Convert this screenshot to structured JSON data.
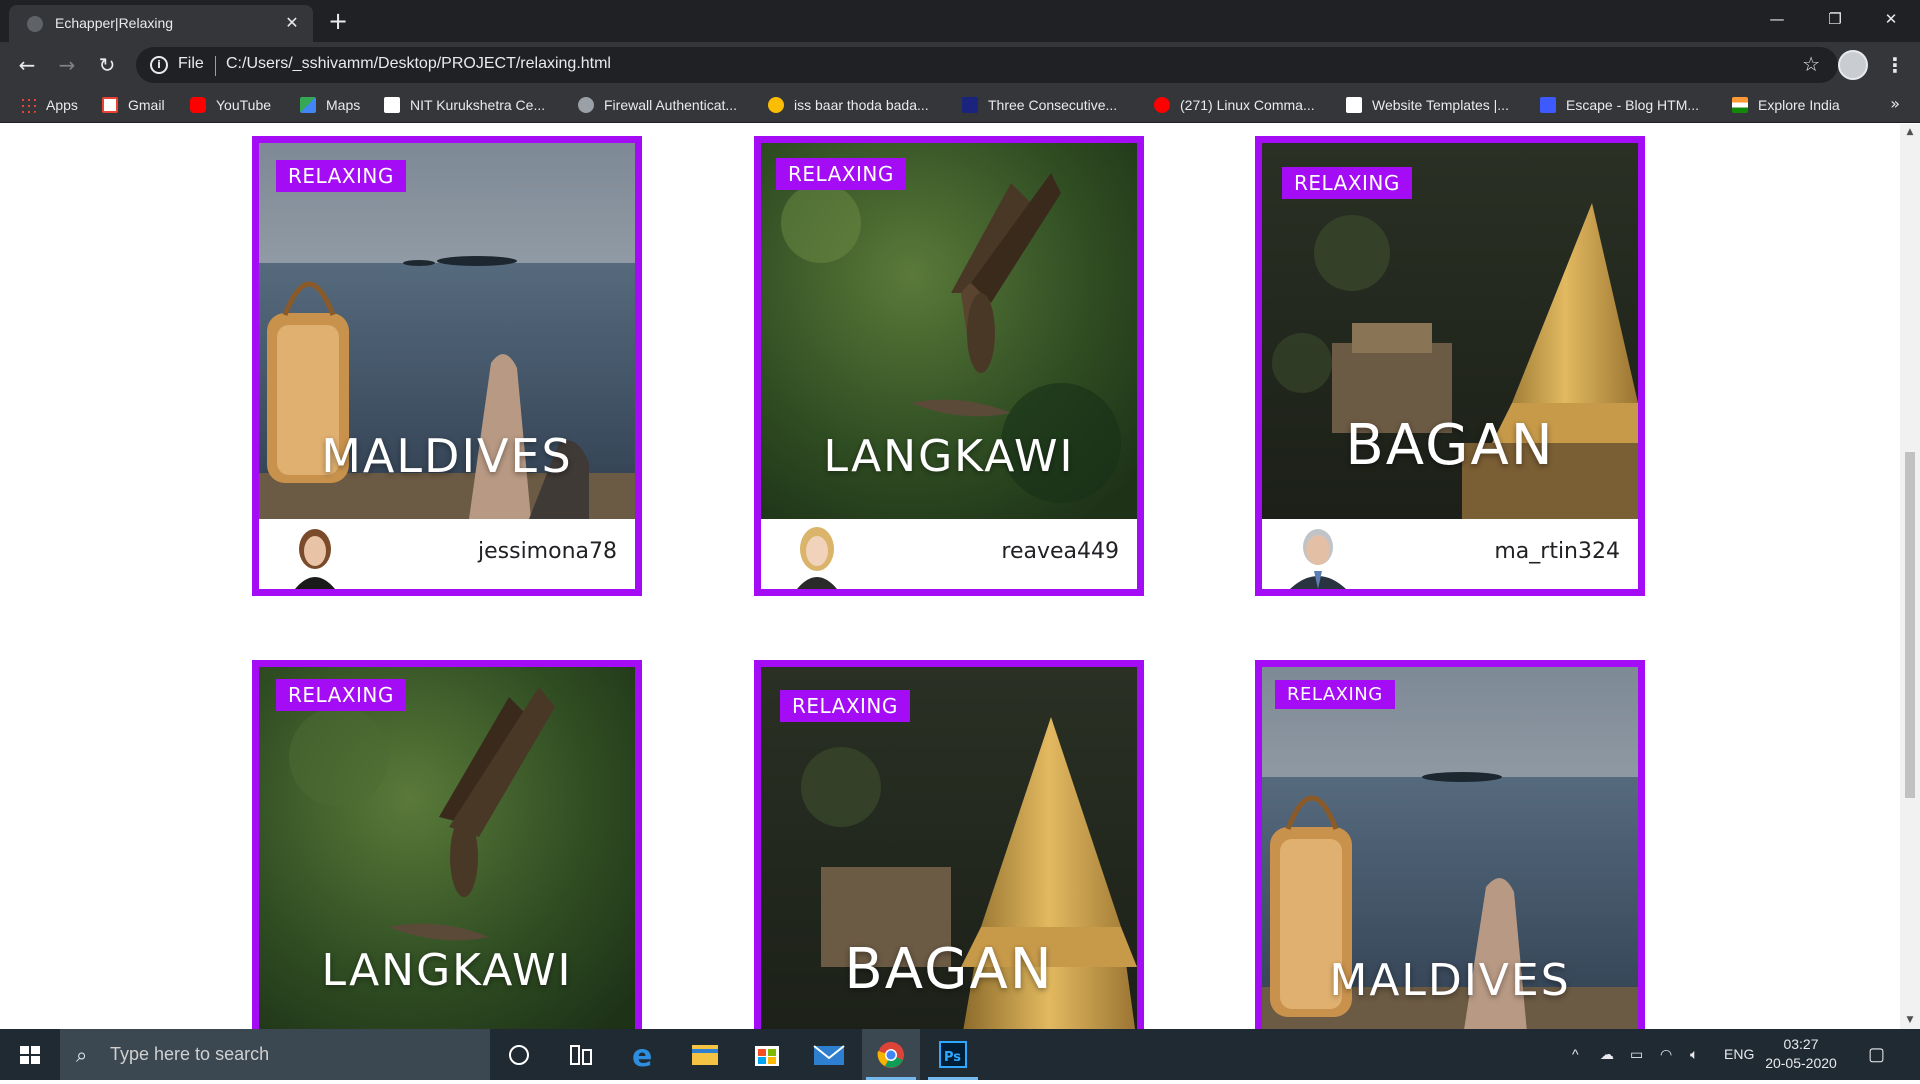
{
  "browser": {
    "tab_title": "Echapper|Relaxing",
    "omnibox": {
      "scheme": "File",
      "url": "C:/Users/_sshivamm/Desktop/PROJECT/relaxing.html"
    },
    "bookmarks": [
      {
        "label": "Apps",
        "color": "#ea4335"
      },
      {
        "label": "Gmail",
        "color": "#ea4335"
      },
      {
        "label": "YouTube",
        "color": "#ff0000"
      },
      {
        "label": "Maps",
        "color": "#34a853"
      },
      {
        "label": "NIT Kurukshetra Ce...",
        "color": "#ffffff"
      },
      {
        "label": "Firewall Authenticat...",
        "color": "#9aa0a6"
      },
      {
        "label": "iss baar thoda bada...",
        "color": "#fbbc04"
      },
      {
        "label": "Three Consecutive...",
        "color": "#1a237e"
      },
      {
        "label": "(271) Linux Comma...",
        "color": "#ff0000"
      },
      {
        "label": "Website Templates |...",
        "color": "#ffffff"
      },
      {
        "label": "Escape - Blog HTM...",
        "color": "#3d5afe"
      },
      {
        "label": "Explore India",
        "color": "#ff9933"
      }
    ]
  },
  "cards": [
    {
      "badge": "RELAXING",
      "place": "MALDIVES",
      "user": "jessimona78"
    },
    {
      "badge": "RELAXING",
      "place": "LANGKAWI",
      "user": "reavea449"
    },
    {
      "badge": "RELAXING",
      "place": "BAGAN",
      "user": "ma_rtin324"
    },
    {
      "badge": "RELAXING",
      "place": "LANGKAWI"
    },
    {
      "badge": "RELAXING",
      "place": "BAGAN"
    },
    {
      "badge": "RELAXING",
      "place": "MALDIVES"
    }
  ],
  "taskbar": {
    "search_placeholder": "Type here to search",
    "language": "ENG",
    "time": "03:27",
    "date": "20-05-2020"
  },
  "colors": {
    "accent": "#a40cf5"
  }
}
